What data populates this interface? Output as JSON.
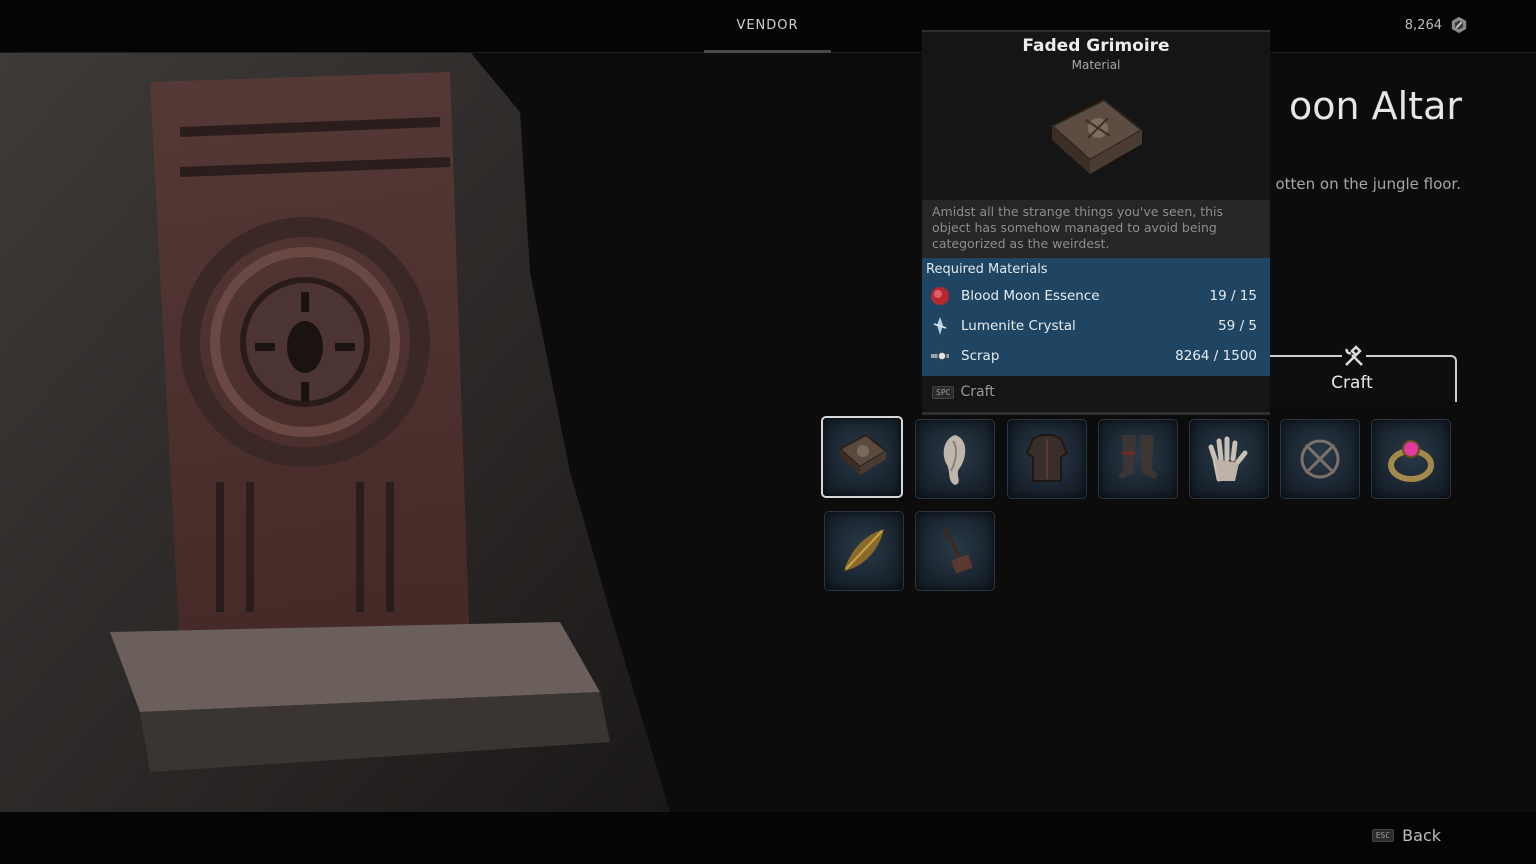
{
  "header": {
    "tab_label": "VENDOR",
    "currency_value": "8,264",
    "currency_icon": "scrap-currency-icon"
  },
  "vendor": {
    "title": "Blood Moon Altar",
    "title_visible": "oon Altar",
    "description_visible": "otten on the jungle floor."
  },
  "tooltip": {
    "item_name": "Faded Grimoire",
    "item_type": "Material",
    "description": "Amidst all the strange things you've seen, this object has somehow managed to avoid being categorized as the weirdest.",
    "required_title": "Required Materials",
    "materials": [
      {
        "name": "Blood Moon Essence",
        "count": "19 / 15",
        "icon": "blood-moon-essence-icon"
      },
      {
        "name": "Lumenite Crystal",
        "count": "59 / 5",
        "icon": "lumenite-crystal-icon"
      },
      {
        "name": "Scrap",
        "count": "8264 / 1500",
        "icon": "scrap-icon"
      }
    ],
    "action_key": "SPC",
    "action_label": "Craft"
  },
  "craft_tab": {
    "label": "Craft",
    "icon": "hammer-wrench-icon"
  },
  "items": [
    {
      "name": "faded-grimoire",
      "selected": true
    },
    {
      "name": "hair-item"
    },
    {
      "name": "chest-armor"
    },
    {
      "name": "leg-armor"
    },
    {
      "name": "gloves"
    },
    {
      "name": "crossed-ring-amulet"
    },
    {
      "name": "pink-gem-ring"
    },
    {
      "name": "golden-feather"
    },
    {
      "name": "mallet"
    }
  ],
  "footer": {
    "back_key": "ESC",
    "back_label": "Back"
  },
  "colors": {
    "background": "#0c0c0c",
    "required_panel": "#1f4562",
    "slot_background": "#1a2530"
  }
}
